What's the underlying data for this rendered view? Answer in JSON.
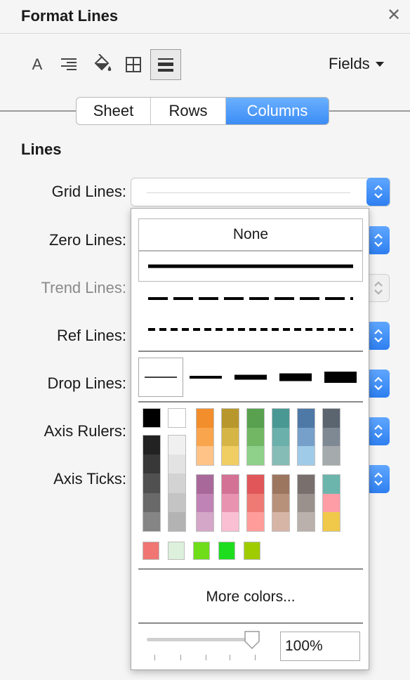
{
  "panel": {
    "title": "Format Lines",
    "close_glyph": "✕"
  },
  "toolbar": {
    "tools": [
      {
        "name": "format-font",
        "glyph": "A"
      },
      {
        "name": "format-alignment"
      },
      {
        "name": "format-shading"
      },
      {
        "name": "format-borders"
      },
      {
        "name": "format-lines",
        "active": true
      }
    ],
    "fields_label": "Fields"
  },
  "tabs": [
    {
      "label": "Sheet",
      "selected": false
    },
    {
      "label": "Rows",
      "selected": false
    },
    {
      "label": "Columns",
      "selected": true
    }
  ],
  "section_title": "Lines",
  "rows": [
    {
      "label": "Grid Lines:",
      "enabled": true
    },
    {
      "label": "Zero Lines:",
      "enabled": true
    },
    {
      "label": "Trend Lines:",
      "enabled": false
    },
    {
      "label": "Ref Lines:",
      "enabled": true
    },
    {
      "label": "Drop Lines:",
      "enabled": true
    },
    {
      "label": "Axis Rulers:",
      "enabled": true
    },
    {
      "label": "Axis Ticks:",
      "enabled": true
    }
  ],
  "popup": {
    "none_label": "None",
    "line_styles": [
      "solid",
      "dashed",
      "dotted"
    ],
    "selected_style": "solid",
    "selected_weight_index": 0,
    "palette": {
      "black": "#000000",
      "white": "#ffffff",
      "grays_dark": [
        "#222222",
        "#383838",
        "#505050",
        "#696969",
        "#858585"
      ],
      "grays_light": [
        "#f0f0f0",
        "#e3e3e3",
        "#d3d3d3",
        "#c4c4c4",
        "#b3b3b3"
      ],
      "top_columns": [
        [
          "#f28e2b",
          "#f9a54d",
          "#ffc387"
        ],
        [
          "#b8972c",
          "#d5b546",
          "#f1ce63"
        ],
        [
          "#59a14f",
          "#72b764",
          "#8fd08a"
        ],
        [
          "#499894",
          "#6bb0ab",
          "#86bcb6"
        ],
        [
          "#4e79a7",
          "#76a0c9",
          "#a0cbe8"
        ],
        [
          "#5b6570",
          "#7e8993",
          "#a5aaad"
        ]
      ],
      "bottom_columns": [
        [
          "#a8699a",
          "#c083b5",
          "#d4a6c8"
        ],
        [
          "#d37295",
          "#e894b0",
          "#fabfd2"
        ],
        [
          "#e15759",
          "#ef7a74",
          "#ff9d9a"
        ],
        [
          "#9d7660",
          "#b8917b",
          "#d7b5a6"
        ],
        [
          "#79706e",
          "#9a918d",
          "#bab0ac"
        ],
        [
          "#6cb5ac",
          "#ff9da7",
          "#f0c84a"
        ]
      ],
      "recent": [
        "#ef7672",
        "#dcf0dc",
        "#6fdd1a",
        "#1edd1e",
        "#9fcc00"
      ]
    },
    "more_colors_label": "More colors...",
    "opacity": {
      "value_label": "100%",
      "value": 1.0
    }
  }
}
